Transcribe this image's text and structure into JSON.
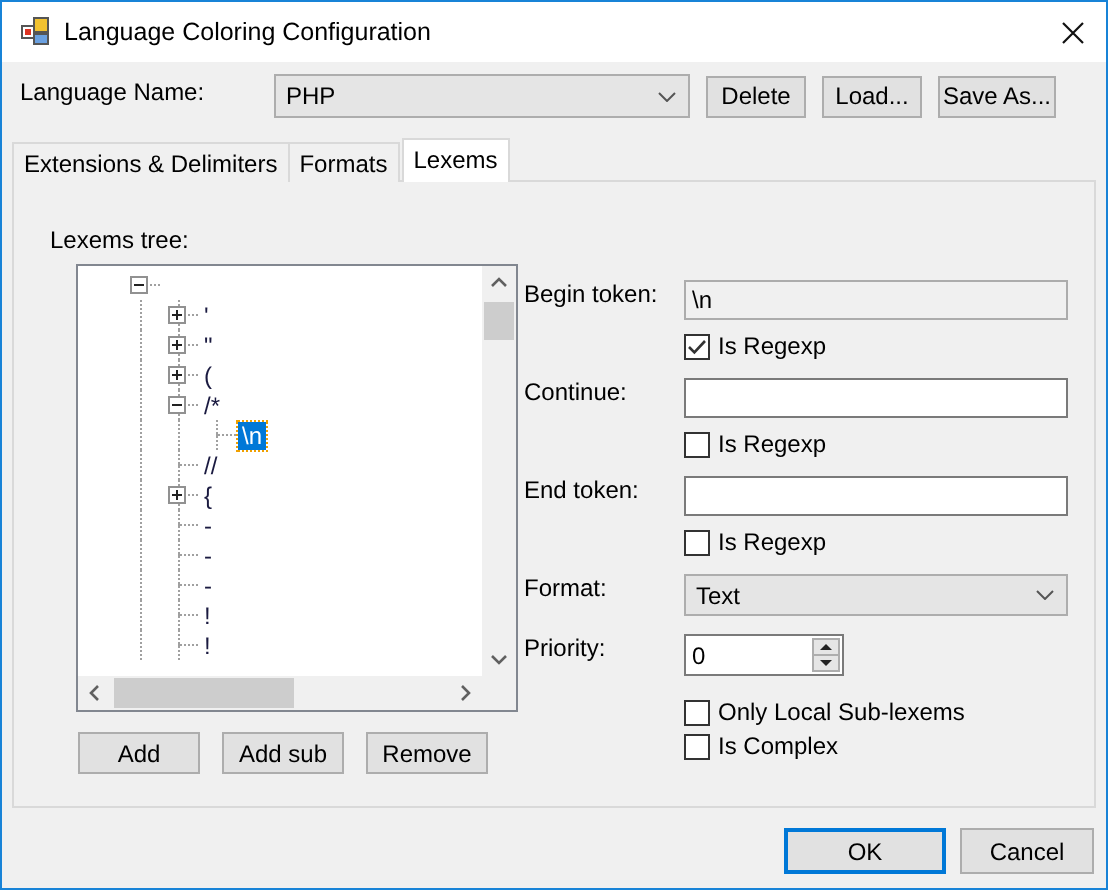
{
  "window": {
    "title": "Language Coloring Configuration"
  },
  "language": {
    "label": "Language Name:",
    "value": "PHP"
  },
  "header_buttons": [
    "Delete",
    "Load...",
    "Save As..."
  ],
  "tabs": [
    {
      "label": "Extensions & Delimiters",
      "selected": false
    },
    {
      "label": "Formats",
      "selected": false
    },
    {
      "label": "Lexems",
      "selected": true
    }
  ],
  "lexems_tree": {
    "label": "Lexems tree:",
    "nodes": [
      {
        "expanded": true,
        "children": [
          {
            "label": "'",
            "expanded": false,
            "selected": false
          },
          {
            "label": "\"",
            "expanded": false,
            "selected": false
          },
          {
            "label": "(",
            "expanded": false,
            "selected": false
          },
          {
            "label": "/*",
            "expanded": true,
            "selected": false,
            "children": [
              {
                "label": "\\n",
                "selected": true
              }
            ]
          },
          {
            "label": "//",
            "selected": false
          },
          {
            "label": "{",
            "expanded": false,
            "selected": false
          },
          {
            "label": "-",
            "selected": false
          },
          {
            "label": "-",
            "selected": false
          },
          {
            "label": "-",
            "selected": false
          },
          {
            "label": "!",
            "selected": false
          },
          {
            "label": "!",
            "selected": false
          }
        ]
      }
    ]
  },
  "tree_buttons": [
    "Add",
    "Add sub",
    "Remove"
  ],
  "token_fields": [
    {
      "label": "Begin token:",
      "value": "\\n",
      "readonly": true,
      "regexp_label": "Is Regexp",
      "regexp_checked": true
    },
    {
      "label": "Continue:",
      "readonly": false,
      "regexp_label": "Is Regexp",
      "regexp_checked": false
    },
    {
      "label": "End token:",
      "readonly": false,
      "regexp_label": "Is Regexp",
      "regexp_checked": false
    }
  ],
  "format": {
    "label": "Format:",
    "value": "Text"
  },
  "priority": {
    "label": "Priority:",
    "value": "0"
  },
  "options": [
    {
      "label": "Only Local Sub-lexems",
      "checked": false
    },
    {
      "label": "Is Complex",
      "checked": false
    }
  ],
  "footer_buttons": [
    {
      "label": "OK",
      "default": true
    },
    {
      "label": "Cancel",
      "default": false
    }
  ]
}
